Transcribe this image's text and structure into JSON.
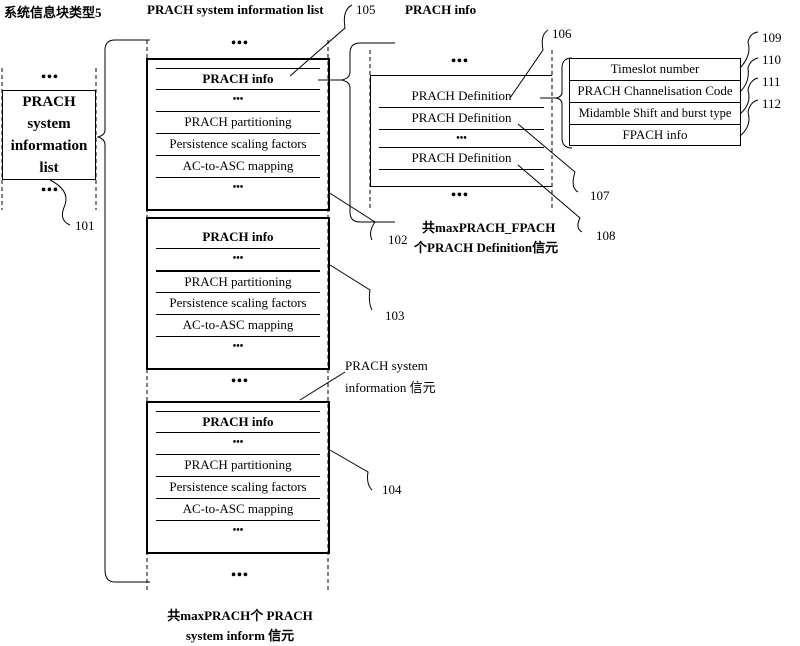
{
  "labels": {
    "sib_type": "系统信息块类型5",
    "prach_sys_info_list_title": "PRACH system information list",
    "prach_info_title": "PRACH info",
    "prach_sys_info_element_line1": "PRACH system",
    "prach_sys_info_element_line2": "information 信元",
    "max_prach_fpach_line1": "共maxPRACH_FPACH",
    "max_prach_fpach_line2": "个PRACH Definition信元",
    "max_prach_line1": "共maxPRACH个 PRACH",
    "max_prach_line2": "system inform 信元"
  },
  "ellipsis": "•••",
  "left_block": {
    "lines": [
      "PRACH",
      "system",
      "information",
      "list"
    ]
  },
  "prach_sys_info_blocks": [
    {
      "ref": "102",
      "rows": [
        "PRACH info",
        "•••",
        "PRACH partitioning",
        "Persistence scaling factors",
        "AC-to-ASC mapping",
        "•••"
      ]
    },
    {
      "ref": "103",
      "rows": [
        "PRACH info",
        "•••",
        "PRACH partitioning",
        "Persistence scaling factors",
        "AC-to-ASC mapping",
        "•••"
      ]
    },
    {
      "ref": "104",
      "rows": [
        "PRACH info",
        "•••",
        "PRACH partitioning",
        "Persistence scaling factors",
        "AC-to-ASC mapping",
        "•••"
      ]
    }
  ],
  "prach_info_block": {
    "rows": [
      "PRACH Definition",
      "PRACH Definition",
      "•••",
      "PRACH Definition"
    ]
  },
  "prach_definition_block": {
    "rows": [
      "Timeslot number",
      "PRACH Channelisation Code",
      "Midamble Shift and burst type",
      "FPACH info"
    ]
  },
  "refs": {
    "r101": "101",
    "r102": "102",
    "r103": "103",
    "r104": "104",
    "r105": "105",
    "r106": "106",
    "r107": "107",
    "r108": "108",
    "r109": "109",
    "r110": "110",
    "r111": "111",
    "r112": "112"
  }
}
